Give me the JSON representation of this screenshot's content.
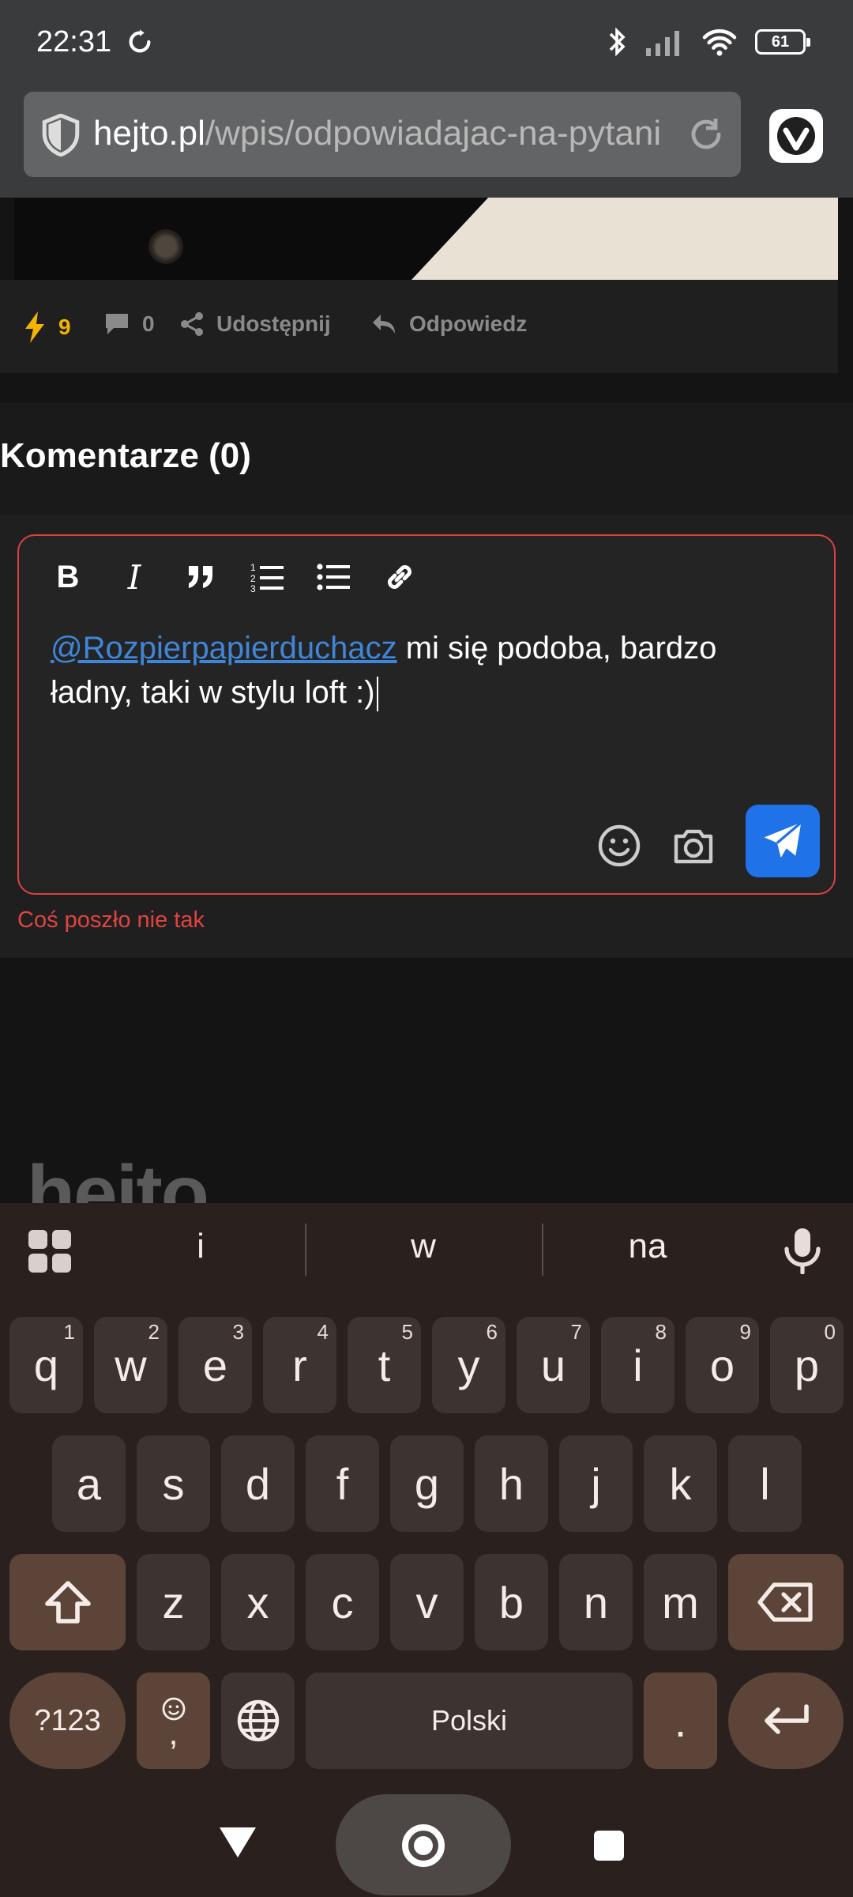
{
  "status_bar": {
    "time": "22:31",
    "battery": "61"
  },
  "browser": {
    "url_host": "hejto.pl",
    "url_path": "/wpis/odpowiadajac-na-pytani"
  },
  "post_actions": {
    "likes": "9",
    "comments": "0",
    "share_label": "Udostępnij",
    "reply_label": "Odpowiedz"
  },
  "comments": {
    "title": "Komentarze (0)"
  },
  "editor": {
    "mention": "@Rozpierpapierduchacz",
    "text": " mi się podoba, bardzo ładny, taki w stylu loft :)",
    "error": "Coś poszło nie tak"
  },
  "footer": {
    "logo": "hejto"
  },
  "keyboard": {
    "suggestions": [
      "i",
      "w",
      "na"
    ],
    "row1": [
      {
        "key": "q",
        "hint": "1"
      },
      {
        "key": "w",
        "hint": "2"
      },
      {
        "key": "e",
        "hint": "3"
      },
      {
        "key": "r",
        "hint": "4"
      },
      {
        "key": "t",
        "hint": "5"
      },
      {
        "key": "y",
        "hint": "6"
      },
      {
        "key": "u",
        "hint": "7"
      },
      {
        "key": "i",
        "hint": "8"
      },
      {
        "key": "o",
        "hint": "9"
      },
      {
        "key": "p",
        "hint": "0"
      }
    ],
    "row2": [
      "a",
      "s",
      "d",
      "f",
      "g",
      "h",
      "j",
      "k",
      "l"
    ],
    "row3": [
      "z",
      "x",
      "c",
      "v",
      "b",
      "n",
      "m"
    ],
    "symbols_label": "?123",
    "comma": ",",
    "space_label": "Polski",
    "period": "."
  },
  "colors": {
    "accent_blue": "#1f72e8",
    "error_red": "#d9433f",
    "like_gold": "#f4b400",
    "mention_blue": "#3f86d8"
  }
}
